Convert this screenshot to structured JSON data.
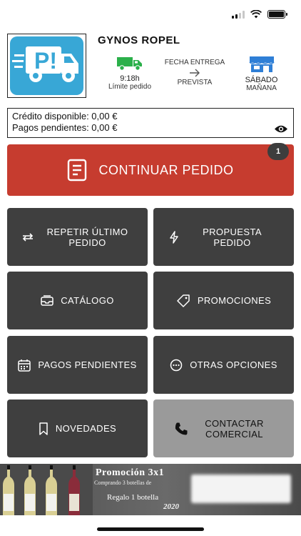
{
  "status_bar": {
    "signal_bars": 4,
    "signal_active": 2
  },
  "header": {
    "company_name": "GYNOS ROPEL",
    "delivery": {
      "time": "9:18h",
      "time_caption": "Límite pedido",
      "date_label": "FECHA ENTREGA",
      "date_caption": "PREVISTA",
      "day": "SÁBADO",
      "day_part": "MAÑANA"
    }
  },
  "credit": {
    "available": "Crédito disponible: 0,00 €",
    "pending": "Pagos pendientes: 0,00 €"
  },
  "continue_order": {
    "label": "CONTINUAR PEDIDO",
    "badge": "1"
  },
  "tiles": {
    "repeat_last": "REPETIR ÚLTIMO PEDIDO",
    "order_proposal": "PROPUESTA PEDIDO",
    "catalog": "CATÁLOGO",
    "promotions": "PROMOCIONES",
    "pending_payments": "PAGOS PENDIENTES",
    "other_options": "OTRAS OPCIONES",
    "news": "NOVEDADES",
    "contact_sales": "CONTACTAR COMERCIAL"
  },
  "banner": {
    "title": "Promoción 3x1",
    "subtitle": "Comprando 3 botellas de",
    "gift": "Regalo 1 botella",
    "year": "2020"
  },
  "colors": {
    "accent_red": "#c63c2f",
    "tile_dark": "#3f3f3f",
    "tile_light": "#9a9a9a",
    "truck_green": "#2bb04a",
    "store_blue": "#2f7fd6",
    "logo_blue": "#38a7d6"
  }
}
